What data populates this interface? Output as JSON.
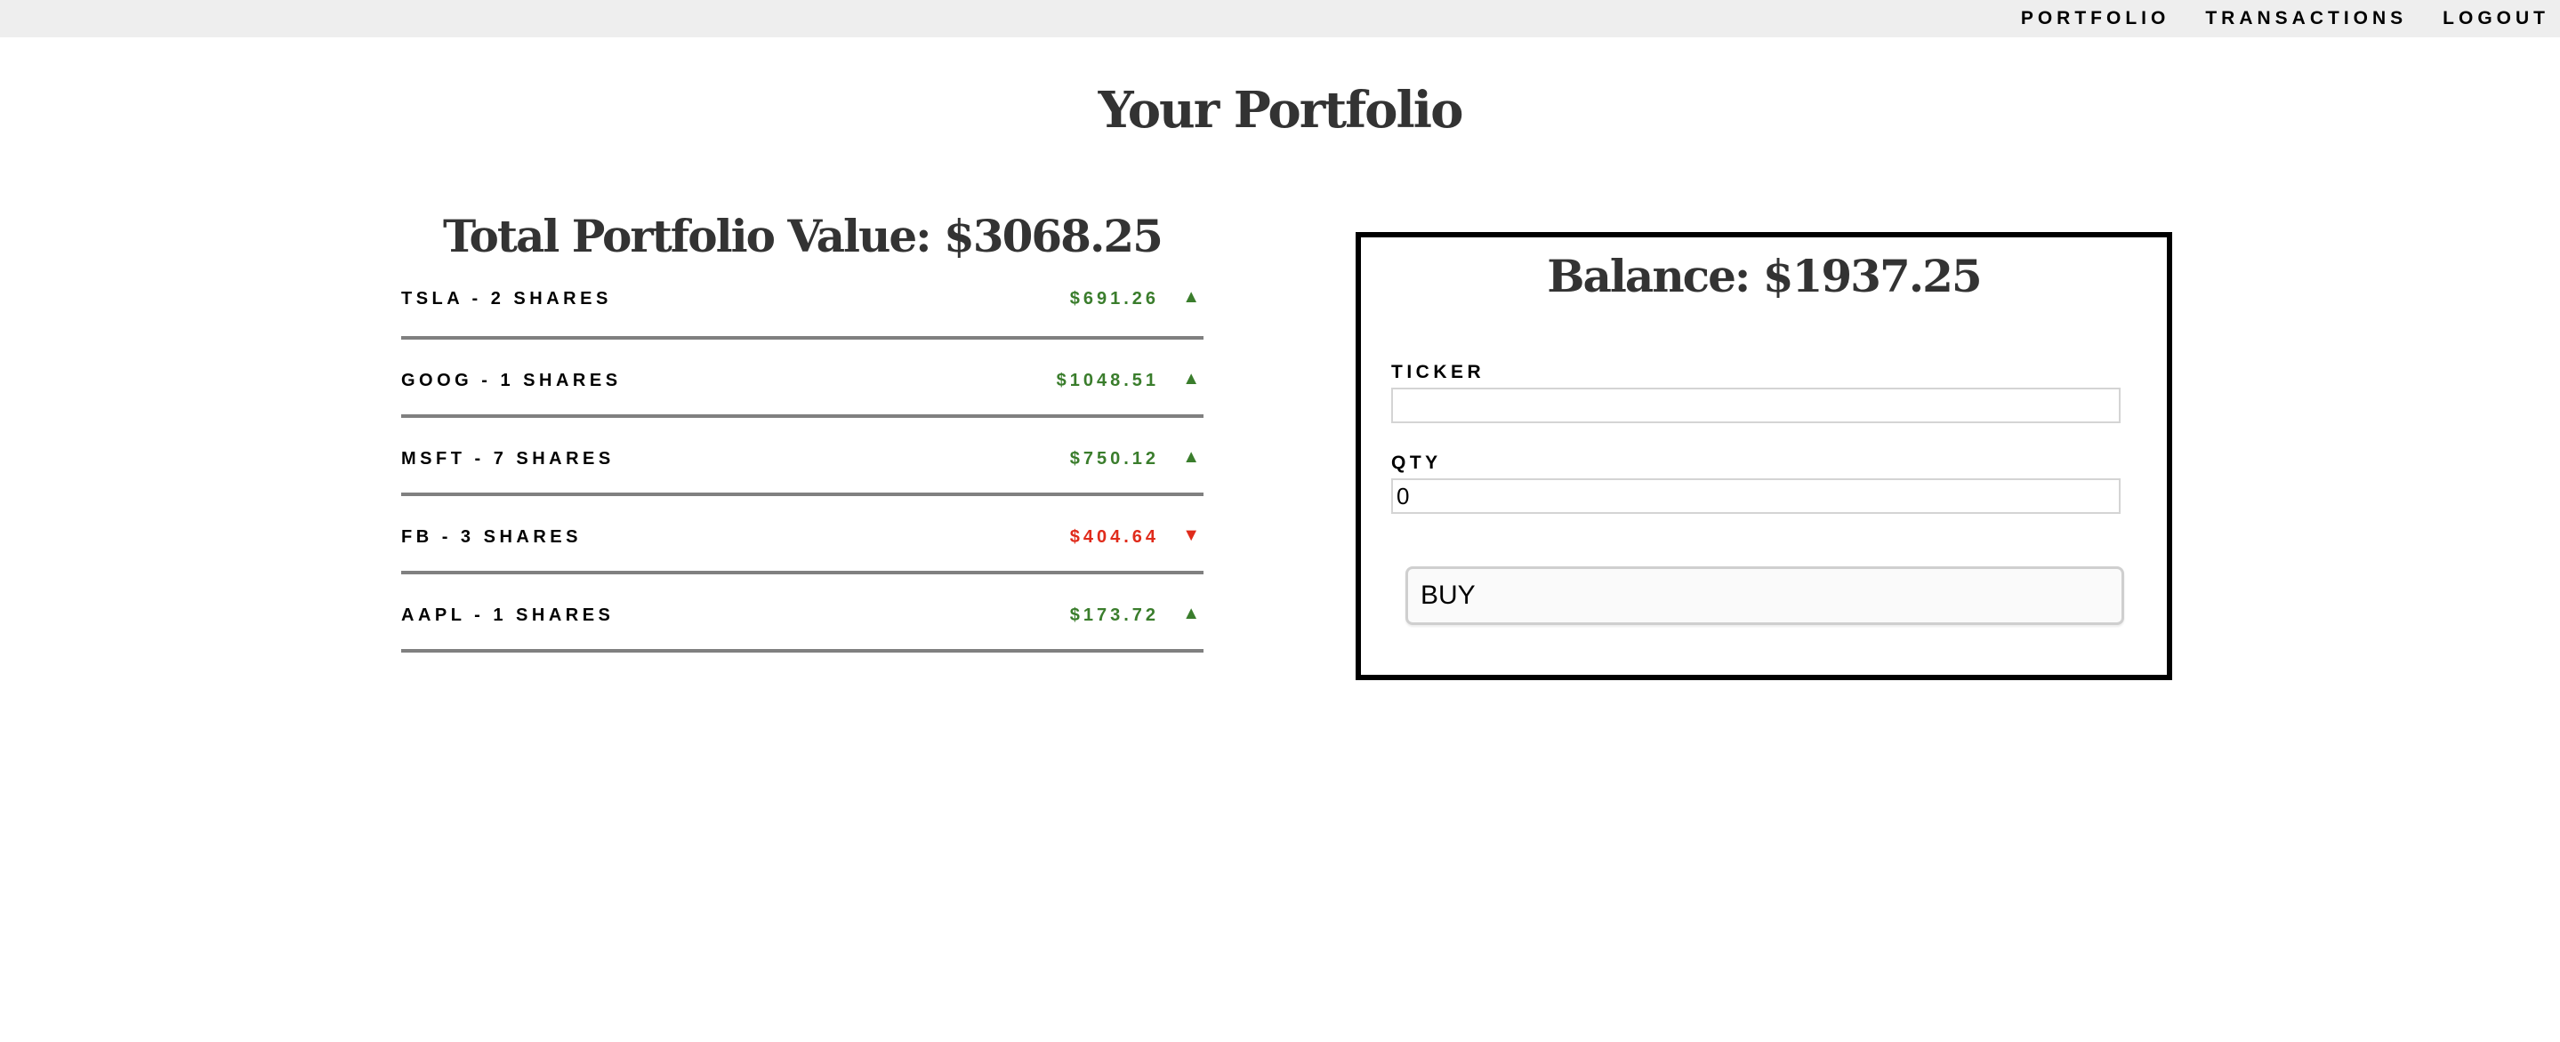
{
  "nav": {
    "portfolio": "PORTFOLIO",
    "transactions": "TRANSACTIONS",
    "logout": "LOGOUT"
  },
  "page_title": "Your Portfolio",
  "portfolio": {
    "total_label": "Total Portfolio Value: $3068.25",
    "holdings": [
      {
        "label": "TSLA - 2 SHARES",
        "value": "$691.26",
        "arrow": "▲",
        "trend": "up"
      },
      {
        "label": "GOOG - 1 SHARES",
        "value": "$1048.51",
        "arrow": "▲",
        "trend": "up"
      },
      {
        "label": "MSFT - 7 SHARES",
        "value": "$750.12",
        "arrow": "▲",
        "trend": "up"
      },
      {
        "label": "FB - 3 SHARES",
        "value": "$404.64",
        "arrow": "▼",
        "trend": "down"
      },
      {
        "label": "AAPL - 1 SHARES",
        "value": "$173.72",
        "arrow": "▲",
        "trend": "up"
      }
    ],
    "colors": {
      "up": "#3a7d2c",
      "down": "#e02b1b"
    }
  },
  "buy_form": {
    "balance_label": "Balance: $1937.25",
    "ticker_label": "TICKER",
    "ticker_value": "",
    "qty_label": "QTY",
    "qty_value": "0",
    "buy_label": "BUY"
  }
}
